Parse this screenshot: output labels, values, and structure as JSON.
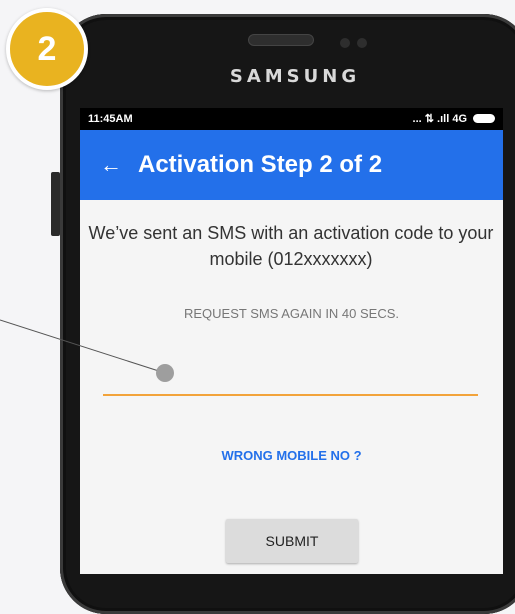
{
  "badge": {
    "step_number": "2",
    "color": "#e9b320"
  },
  "device": {
    "brand": "SAMSUNG"
  },
  "status_bar": {
    "time": "11:45AM",
    "signal_text": "... ⇅ .ıll 4G"
  },
  "app_bar": {
    "back_icon": "arrow-left-icon",
    "title": "Activation Step 2 of 2",
    "color": "#2370ea"
  },
  "content": {
    "message": "We’ve sent an SMS with an activation code to your mobile (012xxxxxxx)",
    "resend_timer": "REQUEST SMS AGAIN IN 40 SECS.",
    "code_input": {
      "value": "",
      "placeholder": ""
    },
    "wrong_mobile_link": "WRONG MOBILE NO ?",
    "submit_label": "SUBMIT"
  },
  "colors": {
    "accent_underline": "#f2a33a",
    "link": "#2370ea"
  }
}
